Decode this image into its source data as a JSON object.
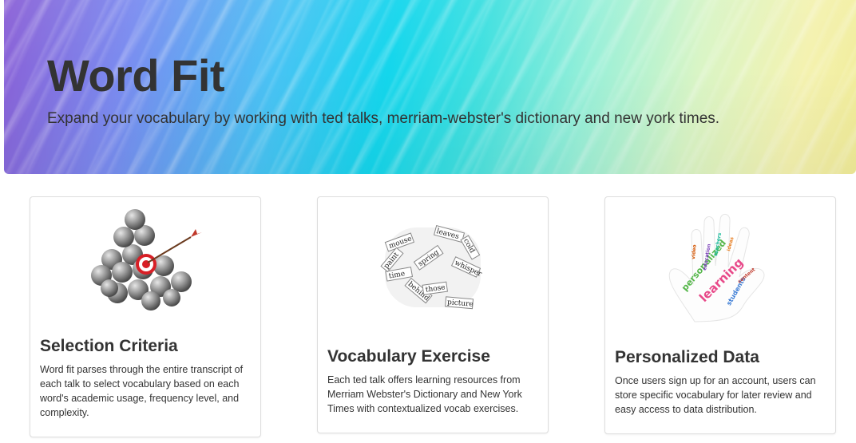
{
  "header": {
    "title": "Word Fit",
    "subtitle": "Expand your vocabulary by working with ted talks, merriam-webster's dictionary and new york times."
  },
  "features": [
    {
      "title": "Selection Criteria",
      "description": "Word fit parses through the entire transcript of each talk to select vocabulary based on each word's academic usage, frequency level, and complexity.",
      "image": "target-spheres-image"
    },
    {
      "title": "Vocabulary Exercise",
      "description": "Each ted talk offers learning resources from Merriam Webster's Dictionary and New York Times with contextualized vocab exercises.",
      "image": "word-pile-image"
    },
    {
      "title": "Personalized Data",
      "description": "Once users sign up for an account, users can store specific vocabulary for later review and easy access to data distribution.",
      "image": "hand-word-cloud-image"
    }
  ],
  "colors": {
    "text": "#333333",
    "border": "#dddddd",
    "target_red": "#d81f26"
  }
}
